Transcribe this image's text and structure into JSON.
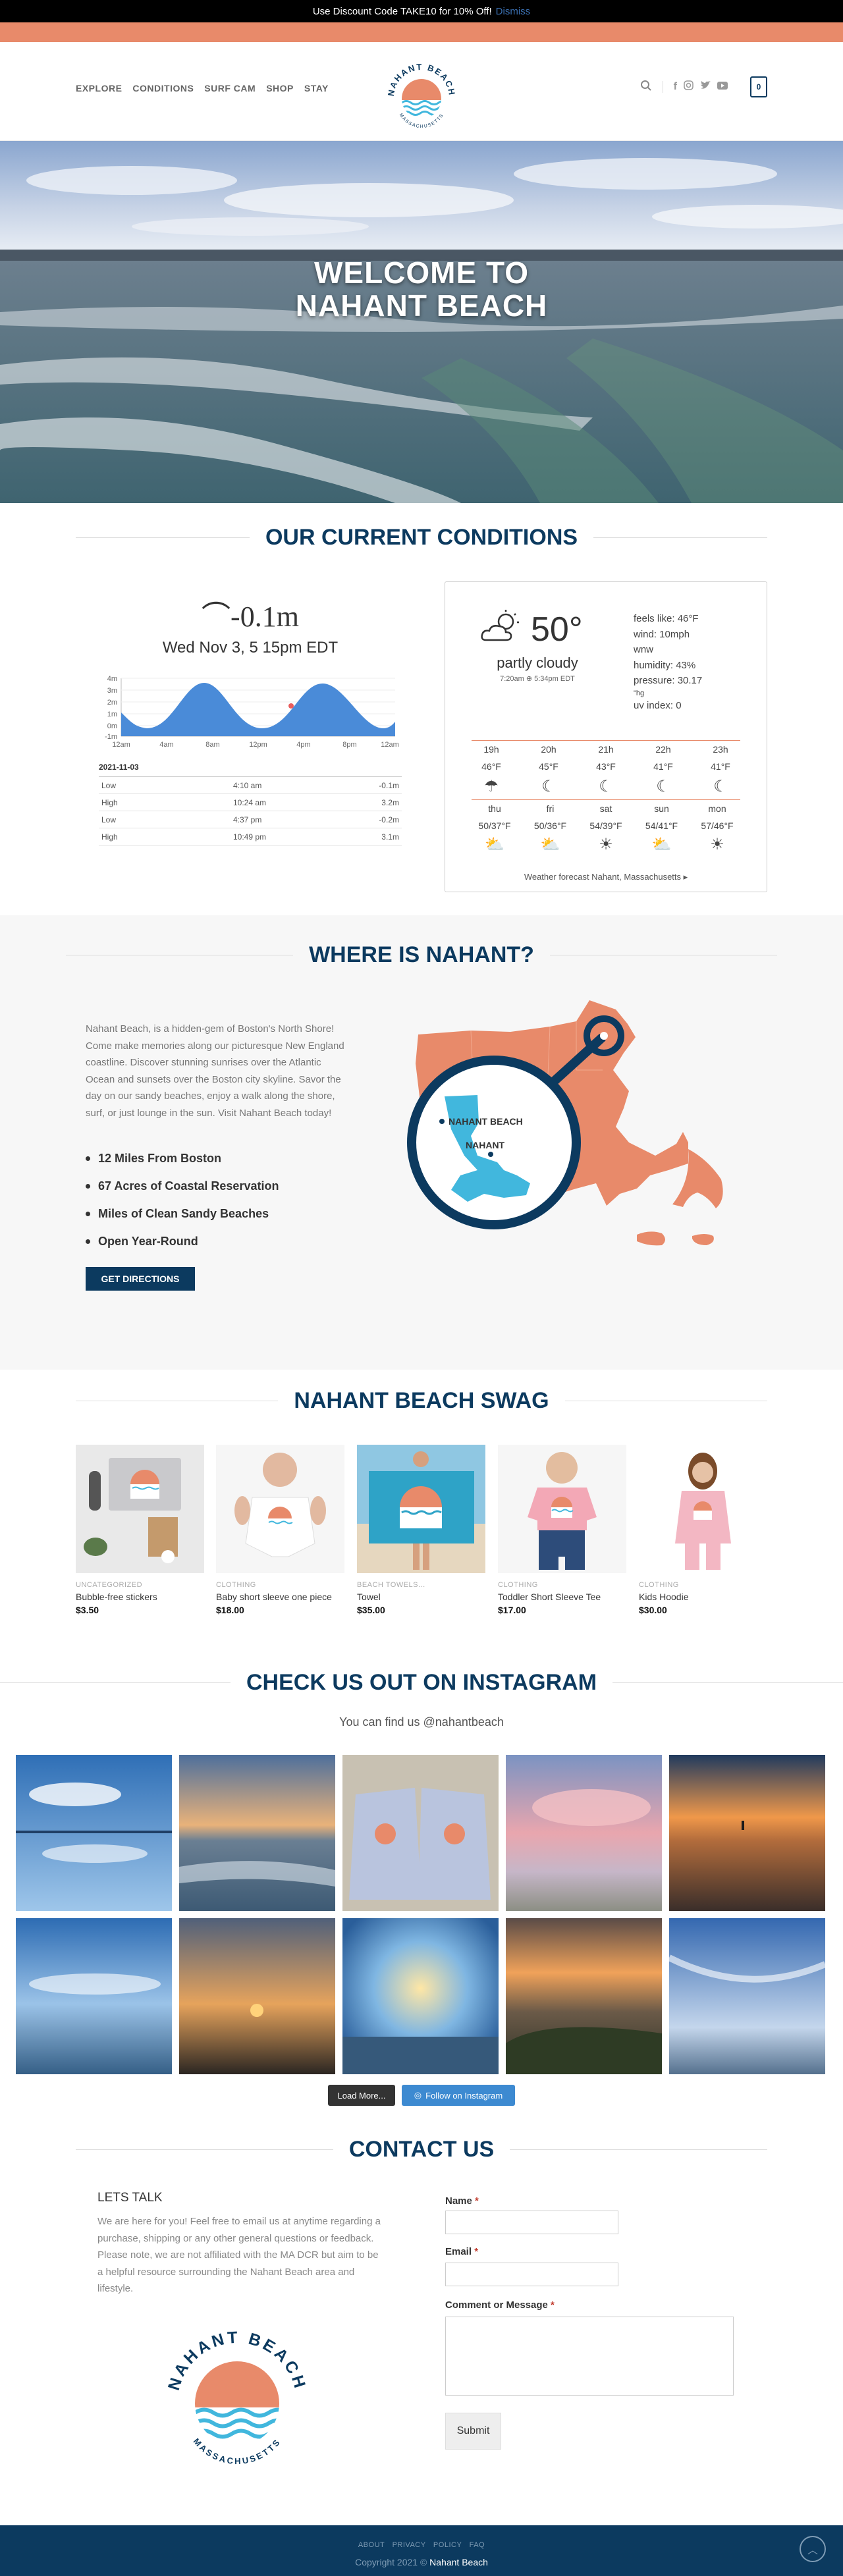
{
  "announcement": {
    "text": "Use Discount Code TAKE10 for 10% Off!",
    "dismiss": "Dismiss"
  },
  "nav": [
    "EXPLORE",
    "CONDITIONS",
    "SURF CAM",
    "SHOP",
    "STAY"
  ],
  "logo": {
    "top": "NAHANT BEACH",
    "bottom": "MASSACHUSETTS"
  },
  "cart_count": "0",
  "hero": {
    "line1": "WELCOME TO",
    "line2": "NAHANT BEACH"
  },
  "conditions": {
    "title": "OUR CURRENT CONDITIONS",
    "tide_height": "-0.1m",
    "tide_time": "Wed Nov 3, 5 15pm EDT",
    "y_ticks": [
      "4m",
      "3m",
      "2m",
      "1m",
      "0m",
      "-1m"
    ],
    "x_ticks": [
      "12am",
      "4am",
      "8am",
      "12pm",
      "4pm",
      "8pm",
      "12am"
    ],
    "date": "2021-11-03",
    "tides": [
      {
        "type": "Low",
        "time": "4:10 am",
        "height": "-0.1m"
      },
      {
        "type": "High",
        "time": "10:24 am",
        "height": "3.2m"
      },
      {
        "type": "Low",
        "time": "4:37 pm",
        "height": "-0.2m"
      },
      {
        "type": "High",
        "time": "10:49 pm",
        "height": "3.1m"
      }
    ],
    "weather": {
      "temp": "50°",
      "summary": "partly cloudy",
      "updated": "7:20am ⊕ 5:34pm EDT",
      "feels_like": "feels like: 46°F",
      "wind": "wind: 10mph",
      "wind_dir": "wnw",
      "humidity": "humidity: 43%",
      "pressure": "pressure: 30.17",
      "pressure_unit": "\"hg",
      "uv": "uv index: 0",
      "hours": [
        {
          "label": "19h",
          "temp": "46°F"
        },
        {
          "label": "20h",
          "temp": "45°F"
        },
        {
          "label": "21h",
          "temp": "43°F"
        },
        {
          "label": "22h",
          "temp": "41°F"
        },
        {
          "label": "23h",
          "temp": "41°F"
        }
      ],
      "days": [
        {
          "label": "thu",
          "temp": "50/37°F"
        },
        {
          "label": "fri",
          "temp": "50/36°F"
        },
        {
          "label": "sat",
          "temp": "54/39°F"
        },
        {
          "label": "sun",
          "temp": "54/41°F"
        },
        {
          "label": "mon",
          "temp": "57/46°F"
        }
      ],
      "footer": "Weather forecast Nahant, Massachusetts ▸"
    }
  },
  "where": {
    "title": "WHERE IS NAHANT?",
    "text": "Nahant Beach, is a hidden-gem of Boston's North Shore! Come make memories along our picturesque New England coastline. Discover stunning sunrises over the Atlantic Ocean and sunsets over the Boston city skyline. Savor the day on our sandy beaches, enjoy a walk along the shore, surf, or just lounge in the sun. Visit Nahant Beach today!",
    "bullets": [
      "12 Miles From Boston",
      "67 Acres of Coastal Reservation",
      "Miles of Clean Sandy Beaches",
      "Open Year-Round"
    ],
    "button": "GET DIRECTIONS",
    "map_label_beach": "NAHANT BEACH",
    "map_label_town": "NAHANT"
  },
  "swag": {
    "title": "NAHANT BEACH SWAG",
    "products": [
      {
        "cat": "UNCATEGORIZED",
        "name": "Bubble-free stickers",
        "price": "$3.50"
      },
      {
        "cat": "CLOTHING",
        "name": "Baby short sleeve one piece",
        "price": "$18.00"
      },
      {
        "cat": "BEACH TOWELS...",
        "name": "Towel",
        "price": "$35.00"
      },
      {
        "cat": "CLOTHING",
        "name": "Toddler Short Sleeve Tee",
        "price": "$17.00"
      },
      {
        "cat": "CLOTHING",
        "name": "Kids Hoodie",
        "price": "$30.00"
      }
    ]
  },
  "instagram": {
    "title": "CHECK US OUT ON INSTAGRAM",
    "sub": "You can find us @nahantbeach",
    "load_more": "Load More...",
    "follow": "Follow on Instagram"
  },
  "contact": {
    "title": "CONTACT US",
    "heading": "LETS TALK",
    "text": "We are here for you! Feel free to email us at anytime regarding a purchase, shipping or any other general questions or feedback. Please note, we are not affiliated with the MA DCR but aim to be a helpful resource surrounding the Nahant Beach area and lifestyle.",
    "name_label": "Name",
    "email_label": "Email",
    "message_label": "Comment or Message",
    "required": "*",
    "submit": "Submit"
  },
  "footer": {
    "links": "ABOUT  PRIVACY POLICY  FAQ",
    "copy": "Copyright 2021 ©",
    "brand": "Nahant Beach"
  },
  "colors": {
    "navy": "#0c3a5f",
    "coral": "#e88a6a",
    "sky": "#41b7dd"
  }
}
